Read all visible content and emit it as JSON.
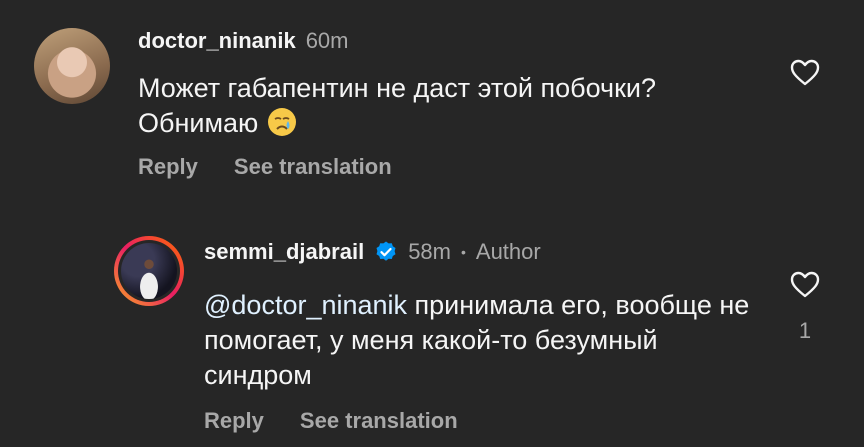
{
  "comments": [
    {
      "username": "doctor_ninanik",
      "time": "60m",
      "text": "Может габапентин не даст этой побочки? Обнимаю",
      "emoji": "crying-face",
      "actions": {
        "reply": "Reply",
        "translate": "See translation"
      }
    },
    {
      "username": "semmi_djabrail",
      "verified": true,
      "time": "58m",
      "separator": "•",
      "author_label": "Author",
      "mention": "@doctor_ninanik",
      "text": "принимала его, вообще не помогает, у меня какой-то безумный синдром",
      "likes": "1",
      "actions": {
        "reply": "Reply",
        "translate": "See translation"
      }
    }
  ],
  "colors": {
    "background": "#262626",
    "primary_text": "#f5f5f5",
    "secondary_text": "#a8a8a8",
    "mention": "#e0f1ff",
    "verified": "#0095f6"
  }
}
